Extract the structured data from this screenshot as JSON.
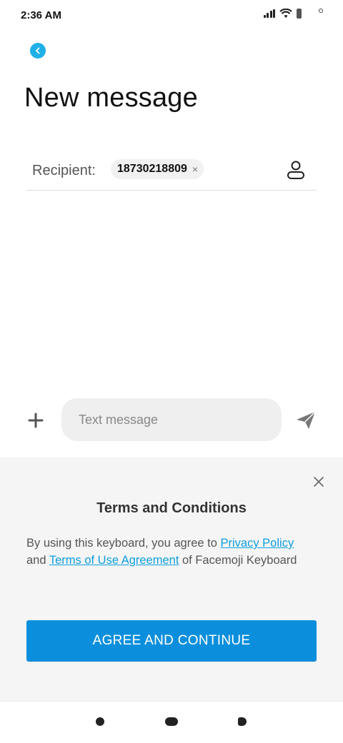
{
  "status_bar": {
    "time": "2:36 AM"
  },
  "header": {
    "title": "New message"
  },
  "recipient": {
    "label": "Recipient:",
    "chip": "18730218809",
    "chip_close": "×"
  },
  "compose": {
    "placeholder": "Text message"
  },
  "terms": {
    "title": "Terms and Conditions",
    "text_1": "By using this keyboard, you agree to ",
    "link_privacy": "Privacy Policy",
    "text_2": " and ",
    "link_terms": "Terms of Use Agreement",
    "text_3": " of Facemoji Keyboard",
    "button": "AGREE AND CONTINUE"
  },
  "colors": {
    "accent": "#1fb0e8",
    "button": "#0b8fdc",
    "link": "#0f9ee0"
  }
}
